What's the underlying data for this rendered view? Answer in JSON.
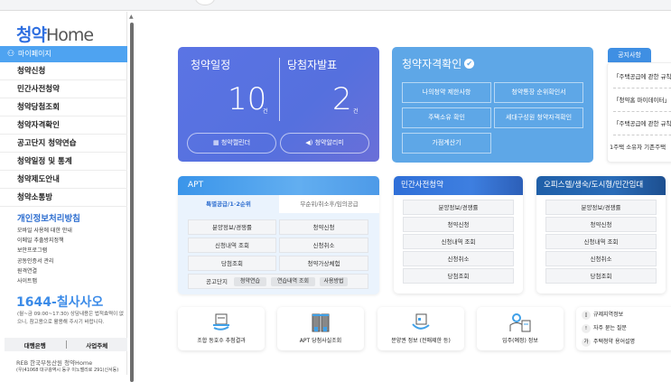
{
  "sidebar": {
    "logo": {
      "prefix": "청약",
      "suffix": "Home"
    },
    "mypage": "마이페이지",
    "menu": [
      "청약신청",
      "민간사전청약",
      "청약당첨조회",
      "청약자격확인",
      "공고단지 청약연습",
      "청약일정 및 통계",
      "청약제도안내",
      "청약소통방"
    ],
    "policy": "개인정보처리방침",
    "links": [
      "모바일 사용에 대한 안내",
      "이메일 추출방지정책",
      "보안프로그램",
      "공동인증서 관리",
      "원격연결",
      "사이트맵"
    ],
    "phone": "1644-칠사사오",
    "phone_note": "(월~금 09:00~17:30) 상담내용은 법적효력이 없으니, 참고용으로 활용해 주시기 바랍니다.",
    "bank": "대행은행",
    "builder": "사업주체",
    "footer_logo": "REB 한국부동산원 청약Home",
    "address": "(우)41068 대구광역시 동구 이노밸리로 291(신서동)"
  },
  "schedule": {
    "title": "청약일정",
    "count": "10",
    "unit": "건",
    "winner_title": "당첨자발표",
    "winner_count": "2",
    "winner_unit": "건",
    "calendar_btn": "청약캘린더",
    "alarm_btn": "청약알리미"
  },
  "qualify": {
    "title": "청약자격확인",
    "buttons": [
      "나의청약 제한사항",
      "청약통장 순위확인서",
      "주택소유 확인",
      "세대구성원 청약자격확인",
      "가점계산기"
    ]
  },
  "notice": {
    "tab": "공지사항",
    "items": [
      "「주택공급에 관한 규칙」",
      "「청약홈 마이데이터」",
      "「주택공급에 관한 규칙」",
      "1주택 소유자 기존주택"
    ]
  },
  "apt": {
    "title": "APT",
    "tabs": [
      "특별공급/1·2순위",
      "무순위/취소후/임의공급"
    ],
    "buttons": [
      "분양정보/경쟁률",
      "청약신청",
      "신청내역 조회",
      "신청취소",
      "당첨조회",
      "청약가상체험"
    ],
    "practice_label": "공고단지",
    "chips": [
      "청약연습",
      "연습내역 조회",
      "사용방법"
    ]
  },
  "private": {
    "title": "민간사전청약",
    "buttons": [
      "분양정보/경쟁률",
      "청약신청",
      "신청내역 조회",
      "신청취소",
      "당첨조회"
    ]
  },
  "officetel": {
    "title": "오피스텔/생숙/도시형/민간임대",
    "buttons": [
      "분양정보/경쟁률",
      "청약신청",
      "신청내역 조회",
      "신청취소",
      "당첨조회"
    ]
  },
  "bottom": {
    "cards": [
      "조합 동호수 추첨결과",
      "APT 당첨사실조회",
      "분양권 정보 (전매제한 등)",
      "입주(예정) 정보"
    ],
    "links": [
      "규제지역정보",
      "자주 묻는 질문",
      "주택청약 용어설명"
    ]
  },
  "colors": {
    "schedule_bg": "#5b74e4",
    "qualify_bg": "#5ea7e7",
    "accent": "#4ea3f1",
    "private_head": "#2f6fd8",
    "officetel_head": "#1f5fa8"
  }
}
